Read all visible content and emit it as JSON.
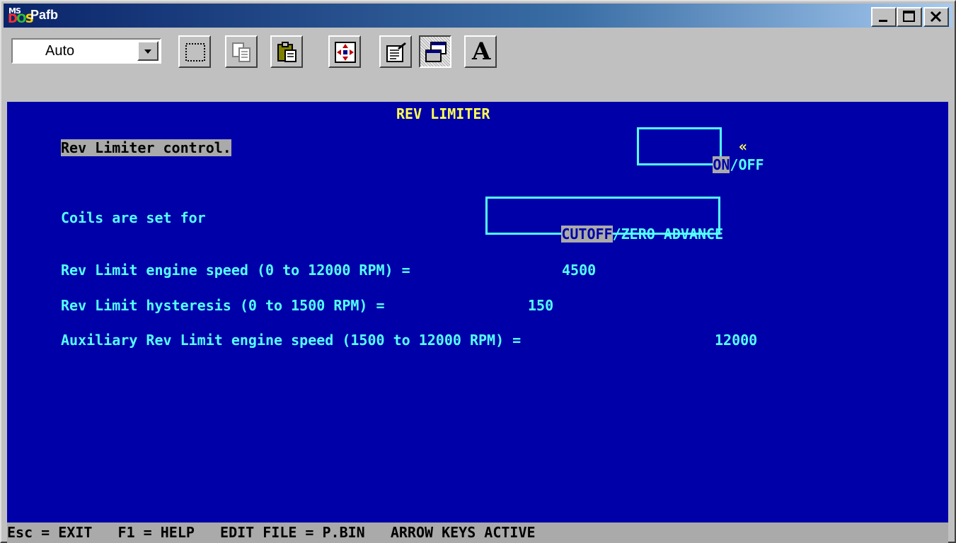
{
  "window": {
    "title": "Pafb",
    "icon_label": "MS-DOS"
  },
  "toolbar": {
    "font_size_value": "Auto",
    "buttons": [
      "mark-icon",
      "copy-icon",
      "paste-icon",
      "fullscreen-icon",
      "properties-icon",
      "background-icon",
      "font-icon"
    ],
    "font_button_glyph": "A"
  },
  "screen": {
    "header": "REV LIMITER",
    "rev_limiter_label": "Rev Limiter control.",
    "onoff": {
      "on": "ON",
      "sep": "/",
      "off": "OFF"
    },
    "marker": "«",
    "coils_label": "Coils are set for",
    "coils": {
      "cutoff": "CUTOFF",
      "sep": "/",
      "zero": "ZERO ADVANCE"
    },
    "engine_speed": {
      "label": "Rev Limit engine speed (0 to 12000 RPM) =",
      "value": "4500"
    },
    "hysteresis": {
      "label": "Rev Limit hysteresis (0 to 1500 RPM) =",
      "value": "150"
    },
    "aux_speed": {
      "label": "Auxiliary Rev Limit engine speed (1500 to 12000 RPM) =",
      "value": "12000"
    }
  },
  "status_bar": {
    "text": "Esc = EXIT   F1 = HELP   EDIT FILE = P.BIN   ARROW KEYS ACTIVE"
  },
  "colors": {
    "screen_bg": "#0000a8",
    "text": "#55ffff",
    "header": "#ffff55",
    "highlight": "#aaaaaa"
  }
}
